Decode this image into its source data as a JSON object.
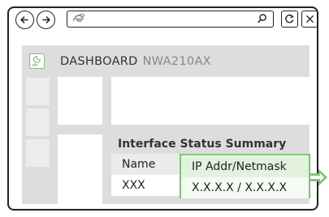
{
  "browser": {
    "toolbar": {
      "back_icon": "arrow-left-icon",
      "forward_icon": "arrow-right-icon",
      "address_icon": "internet-explorer-icon",
      "search_icon": "magnifier-icon",
      "refresh_icon": "refresh-icon",
      "close_icon": "close-icon"
    }
  },
  "app": {
    "logo_icon": "dashboard-logo-icon",
    "title": "DASHBOARD",
    "subtitle": "NWA210AX",
    "accent_color": "#7cc576"
  },
  "table": {
    "title": "Interface Status Summary",
    "columns": [
      "Name",
      "IP Addr/Netmask"
    ],
    "rows": [
      [
        "XXX",
        "X.X.X.X / X.X.X.X"
      ]
    ]
  }
}
